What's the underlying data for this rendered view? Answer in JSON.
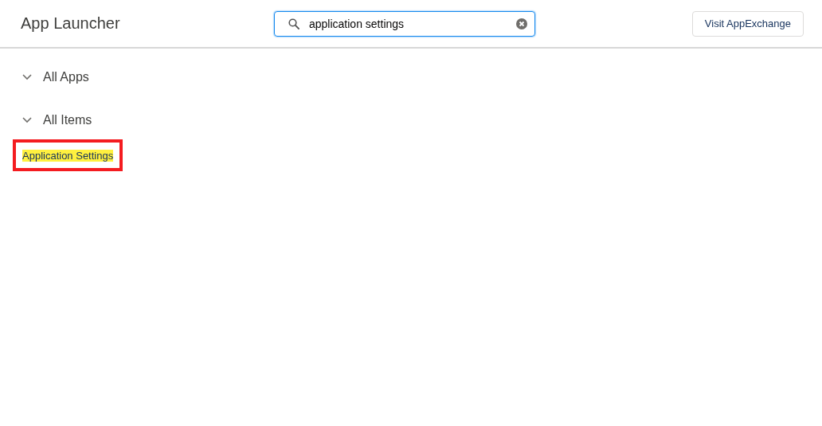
{
  "header": {
    "title": "App Launcher",
    "search": {
      "value": "application settings"
    },
    "button": "Visit AppExchange"
  },
  "sections": [
    {
      "label": "All Apps",
      "expanded": true
    },
    {
      "label": "All Items",
      "expanded": true,
      "items": [
        {
          "label": "Application Settings",
          "highlighted": true,
          "outlined": true
        }
      ]
    }
  ]
}
